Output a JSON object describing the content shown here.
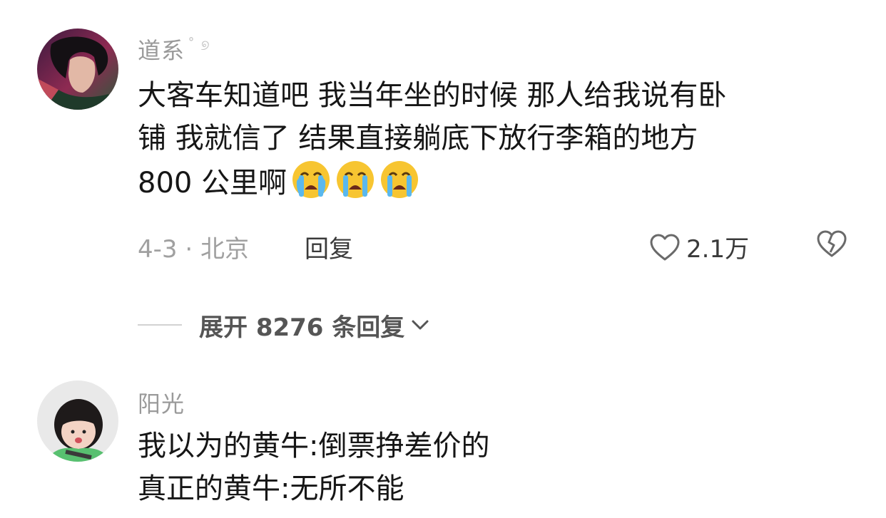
{
  "comments": [
    {
      "username": "道系",
      "username_suffix": "˚ ୭",
      "lines": [
        "大客车知道吧 我当年坐的时候 那人给我说有卧",
        "铺 我就信了 结果直接躺底下放行李箱的地方",
        "800 公里啊"
      ],
      "emoji": [
        "loudly-crying-face",
        "loudly-crying-face",
        "loudly-crying-face"
      ],
      "date_location": "4-3 · 北京",
      "reply_label": "回复",
      "likes": "2.1万"
    },
    {
      "username": "阳光",
      "lines": [
        "我以为的黄牛:倒票挣差价的",
        "真正的黄牛:无所不能"
      ]
    }
  ],
  "expand_replies": {
    "label": "展开 8276 条回复"
  },
  "icons": {
    "like": "heart-outline-icon",
    "dislike": "broken-heart-icon",
    "expand": "chevron-down-icon"
  },
  "colors": {
    "text": "#161616",
    "meta": "#a0a0a0",
    "username": "#9a9a9a"
  }
}
